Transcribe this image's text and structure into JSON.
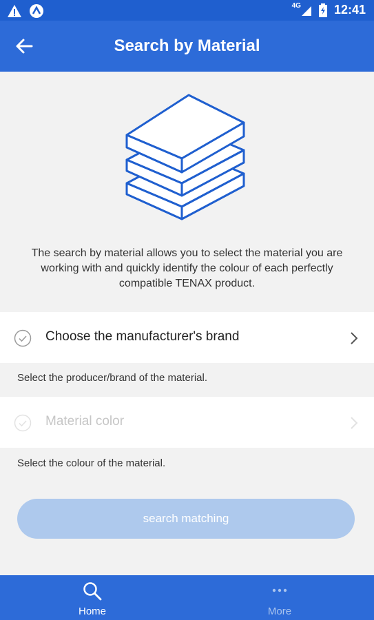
{
  "status_bar": {
    "time": "12:41",
    "network": "4G"
  },
  "app_bar": {
    "title": "Search by Material"
  },
  "intro_text": "The search by material  allows you to select the material you are working with and quickly identify the colour of each perfectly compatible TENAX product.",
  "options": [
    {
      "label": "Choose the manufacturer's brand",
      "helper": "Select the producer/brand of the material.",
      "enabled": true
    },
    {
      "label": "Material color",
      "helper": "Select the colour of the material.",
      "enabled": false
    }
  ],
  "search_button": {
    "label": "search matching"
  },
  "bottom_nav": [
    {
      "label": "Home",
      "icon": "search-icon",
      "active": true
    },
    {
      "label": "More",
      "icon": "more-dots-icon",
      "active": false
    }
  ],
  "colors": {
    "primary": "#2d6bd8",
    "status_bar": "#1f5fcf",
    "button_disabled": "#aec9ed",
    "background": "#f2f2f2"
  }
}
